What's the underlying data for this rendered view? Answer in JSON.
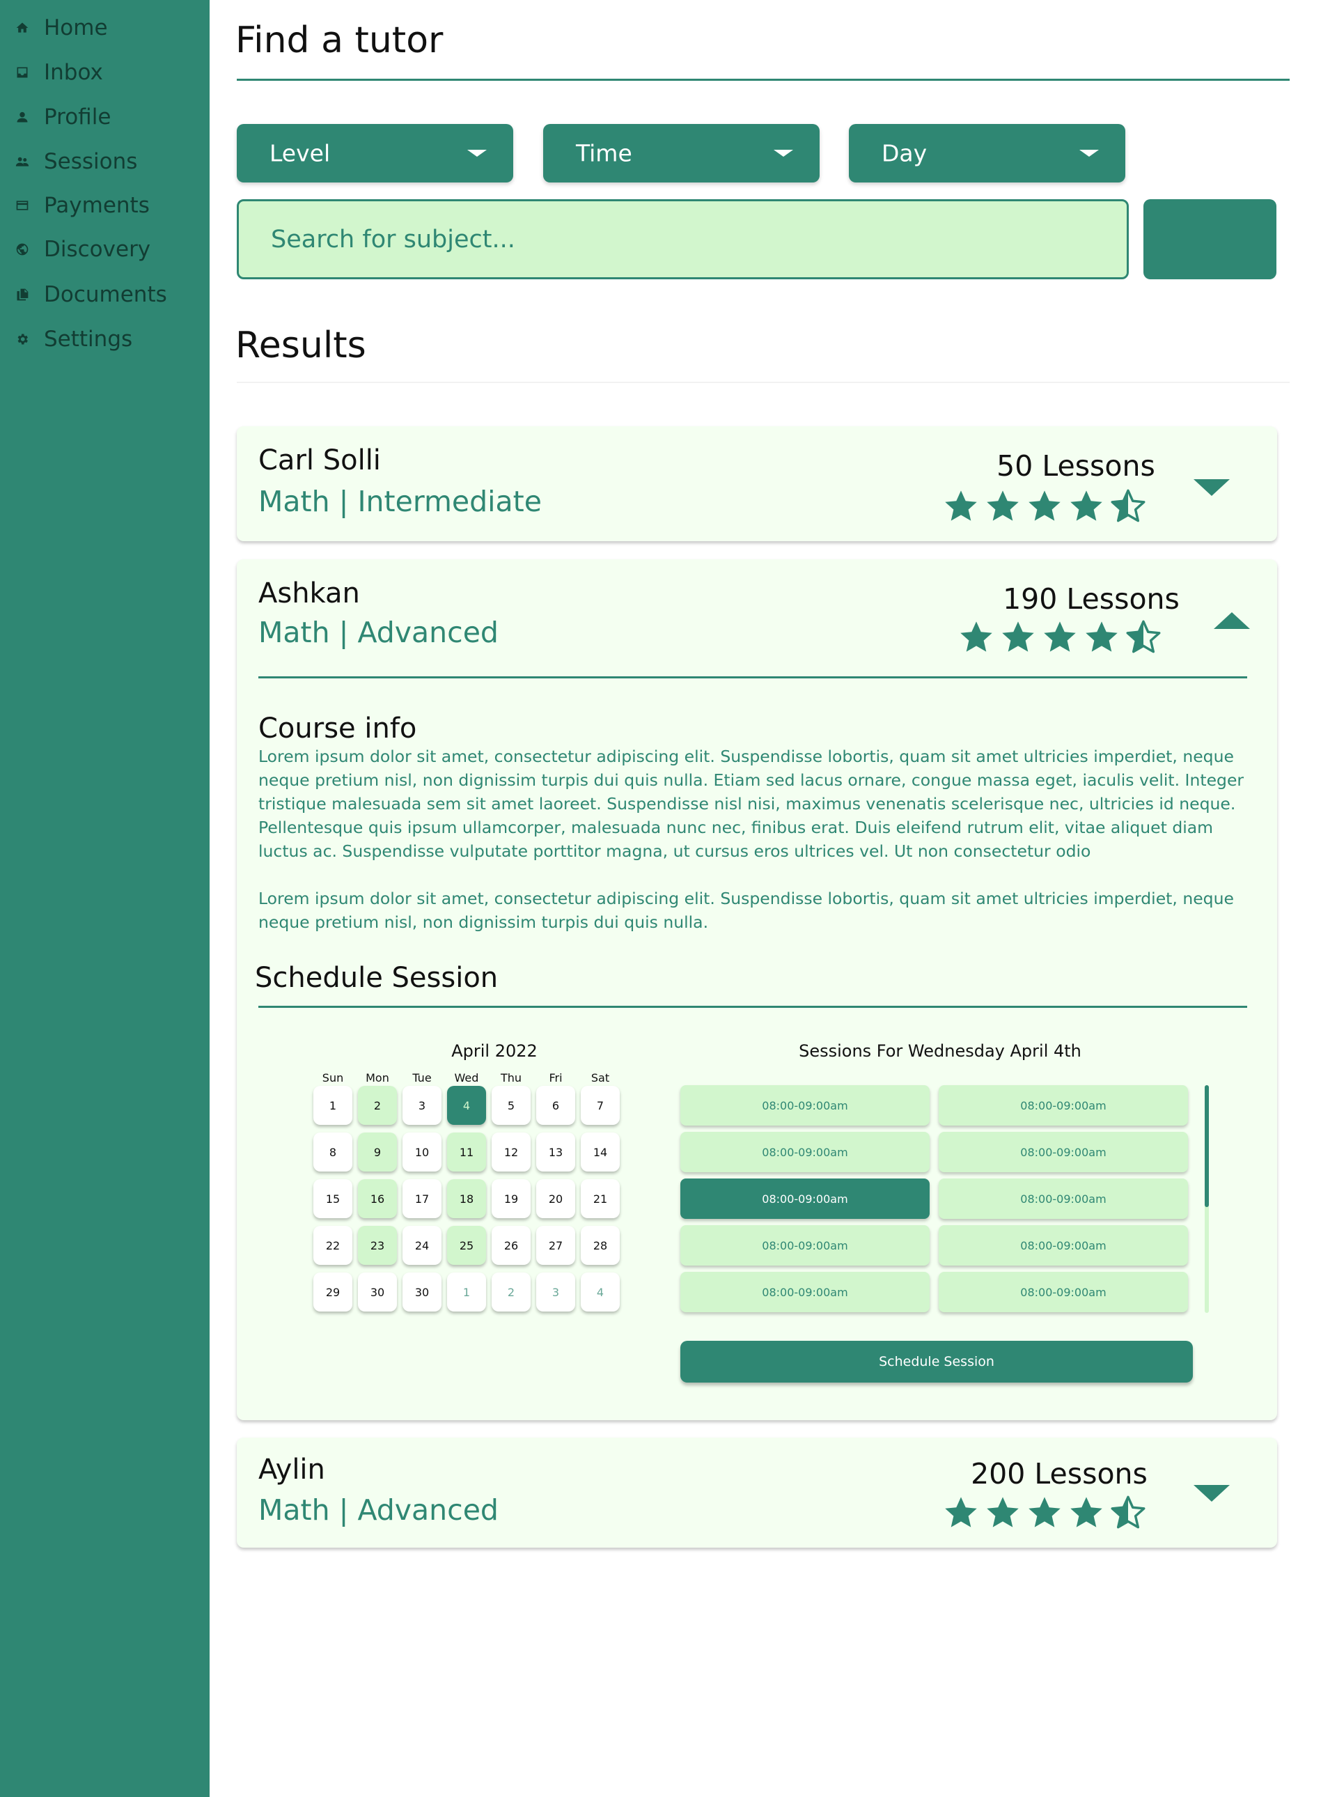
{
  "sidebar": {
    "items": [
      {
        "label": "Home",
        "icon": "home-icon"
      },
      {
        "label": "Inbox",
        "icon": "inbox-icon"
      },
      {
        "label": "Profile",
        "icon": "person-icon"
      },
      {
        "label": "Sessions",
        "icon": "people-icon"
      },
      {
        "label": "Payments",
        "icon": "credit-card-icon"
      },
      {
        "label": "Discovery",
        "icon": "globe-icon"
      },
      {
        "label": "Documents",
        "icon": "documents-icon"
      },
      {
        "label": "Settings",
        "icon": "gear-icon"
      }
    ]
  },
  "header": {
    "title": "Find a tutor"
  },
  "filters": {
    "level": "Level",
    "time": "Time",
    "day": "Day"
  },
  "search": {
    "placeholder": "Search for subject..."
  },
  "results": {
    "title": "Results",
    "tutors": [
      {
        "name": "Carl Solli",
        "meta": "Math | Intermediate",
        "lessons": "50 Lessons",
        "rating": 4.5,
        "expanded": false
      },
      {
        "name": "Ashkan",
        "meta": "Math | Advanced",
        "lessons": "190 Lessons",
        "rating": 4.5,
        "expanded": true,
        "course_info_title": "Course info",
        "course_info_p1": "Lorem ipsum dolor sit amet, consectetur adipiscing elit. Suspendisse lobortis, quam sit amet ultricies imperdiet, neque neque pretium nisl, non dignissim turpis dui quis nulla. Etiam sed lacus ornare, congue massa eget, iaculis velit. Integer tristique malesuada sem sit amet laoreet. Suspendisse nisl nisi, maximus venenatis scelerisque nec, ultricies id neque. Pellentesque quis ipsum ullamcorper, malesuada nunc nec, finibus erat. Duis eleifend rutrum elit, vitae aliquet diam luctus ac. Suspendisse vulputate porttitor magna, ut cursus eros ultrices vel. Ut non consectetur odio",
        "course_info_p2": "Lorem ipsum dolor sit amet, consectetur adipiscing elit. Suspendisse lobortis, quam sit amet ultricies imperdiet, neque neque pretium nisl, non dignissim turpis dui quis nulla.",
        "schedule_title": "Schedule Session",
        "calendar": {
          "month": "April 2022",
          "weekdays": [
            "Sun",
            "Mon",
            "Tue",
            "Wed",
            "Thu",
            "Fri",
            "Sat"
          ],
          "weeks": [
            [
              {
                "d": "1"
              },
              {
                "d": "2",
                "s": "avail"
              },
              {
                "d": "3"
              },
              {
                "d": "4",
                "s": "selected"
              },
              {
                "d": "5"
              },
              {
                "d": "6"
              },
              {
                "d": "7"
              }
            ],
            [
              {
                "d": "8"
              },
              {
                "d": "9",
                "s": "avail"
              },
              {
                "d": "10"
              },
              {
                "d": "11",
                "s": "avail"
              },
              {
                "d": "12"
              },
              {
                "d": "13"
              },
              {
                "d": "14"
              }
            ],
            [
              {
                "d": "15"
              },
              {
                "d": "16",
                "s": "avail"
              },
              {
                "d": "17"
              },
              {
                "d": "18",
                "s": "avail"
              },
              {
                "d": "19"
              },
              {
                "d": "20"
              },
              {
                "d": "21"
              }
            ],
            [
              {
                "d": "22"
              },
              {
                "d": "23",
                "s": "avail"
              },
              {
                "d": "24"
              },
              {
                "d": "25",
                "s": "avail"
              },
              {
                "d": "26"
              },
              {
                "d": "27"
              },
              {
                "d": "28"
              }
            ],
            [
              {
                "d": "29"
              },
              {
                "d": "30"
              },
              {
                "d": "30"
              },
              {
                "d": "1",
                "s": "other"
              },
              {
                "d": "2",
                "s": "other"
              },
              {
                "d": "3",
                "s": "other"
              },
              {
                "d": "4",
                "s": "other"
              }
            ]
          ]
        },
        "sessions_title": "Sessions For Wednesday April 4th",
        "slots": [
          [
            "08:00-09:00am",
            "08:00-09:00am"
          ],
          [
            "08:00-09:00am",
            "08:00-09:00am"
          ],
          [
            "08:00-09:00am",
            "08:00-09:00am"
          ],
          [
            "08:00-09:00am",
            "08:00-09:00am"
          ],
          [
            "08:00-09:00am",
            "08:00-09:00am"
          ]
        ],
        "selected_slot": {
          "row": 2,
          "col": 0
        },
        "schedule_button": "Schedule Session"
      },
      {
        "name": "Aylin",
        "meta": "Math | Advanced",
        "lessons": "200 Lessons",
        "rating": 4.5,
        "expanded": false
      }
    ]
  },
  "colors": {
    "primary": "#2f8773",
    "sidebar_text": "#123d33",
    "light_green": "#d2f6cd",
    "card_bg": "#f4fff1"
  }
}
